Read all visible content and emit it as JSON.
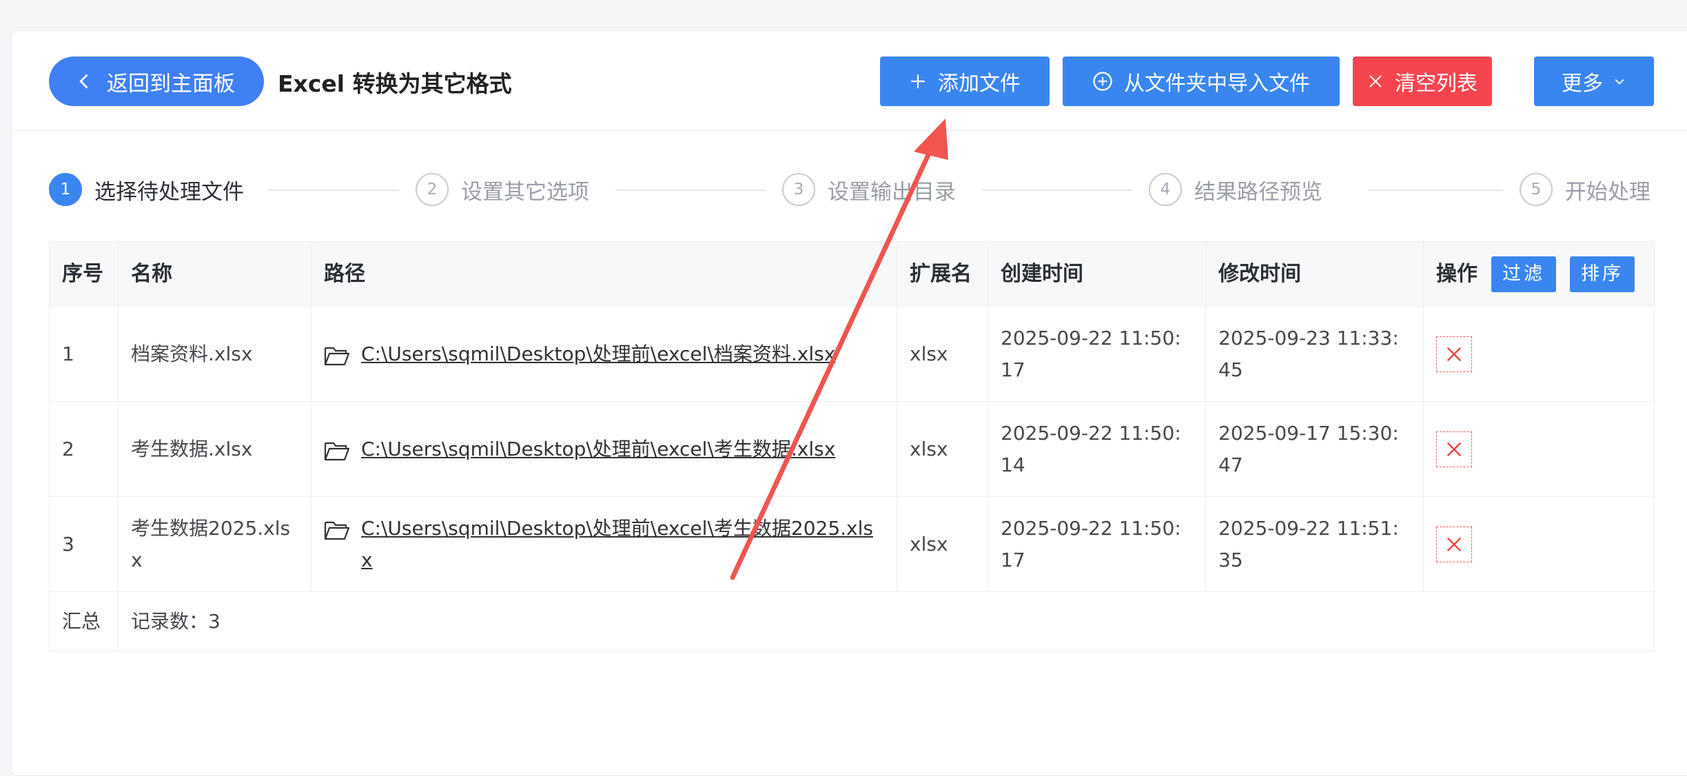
{
  "header": {
    "back_label": "返回到主面板",
    "title": "Excel 转换为其它格式",
    "add_file_label": "添加文件",
    "import_folder_label": "从文件夹中导入文件",
    "clear_list_label": "清空列表",
    "more_label": "更多"
  },
  "steps": [
    {
      "num": "1",
      "label": "选择待处理文件"
    },
    {
      "num": "2",
      "label": "设置其它选项"
    },
    {
      "num": "3",
      "label": "设置输出目录"
    },
    {
      "num": "4",
      "label": "结果路径预览"
    },
    {
      "num": "5",
      "label": "开始处理"
    }
  ],
  "table": {
    "columns": [
      "序号",
      "名称",
      "路径",
      "扩展名",
      "创建时间",
      "修改时间",
      "操作"
    ],
    "filter_label": "过滤",
    "sort_label": "排序",
    "rows": [
      {
        "index": "1",
        "name": "档案资料.xlsx",
        "path": "C:\\Users\\sqmil\\Desktop\\处理前\\excel\\档案资料.xlsx",
        "ext": "xlsx",
        "created": "2025-09-22 11:50:17",
        "modified": "2025-09-23 11:33:45"
      },
      {
        "index": "2",
        "name": "考生数据.xlsx",
        "path": "C:\\Users\\sqmil\\Desktop\\处理前\\excel\\考生数据.xlsx",
        "ext": "xlsx",
        "created": "2025-09-22 11:50:14",
        "modified": "2025-09-17 15:30:47"
      },
      {
        "index": "3",
        "name": "考生数据2025.xlsx",
        "path": "C:\\Users\\sqmil\\Desktop\\处理前\\excel\\考生数据2025.xlsx",
        "ext": "xlsx",
        "created": "2025-09-22 11:50:17",
        "modified": "2025-09-22 11:51:35"
      }
    ],
    "summary_label": "汇总",
    "summary_value": "记录数：3"
  },
  "colors": {
    "primary": "#3a86f0",
    "danger": "#f6454f",
    "annotation_arrow": "#f0554f"
  },
  "icons": [
    "chevron-left-icon",
    "plus-icon",
    "circle-plus-icon",
    "close-icon",
    "chevron-down-icon",
    "folder-icon",
    "delete-icon"
  ]
}
